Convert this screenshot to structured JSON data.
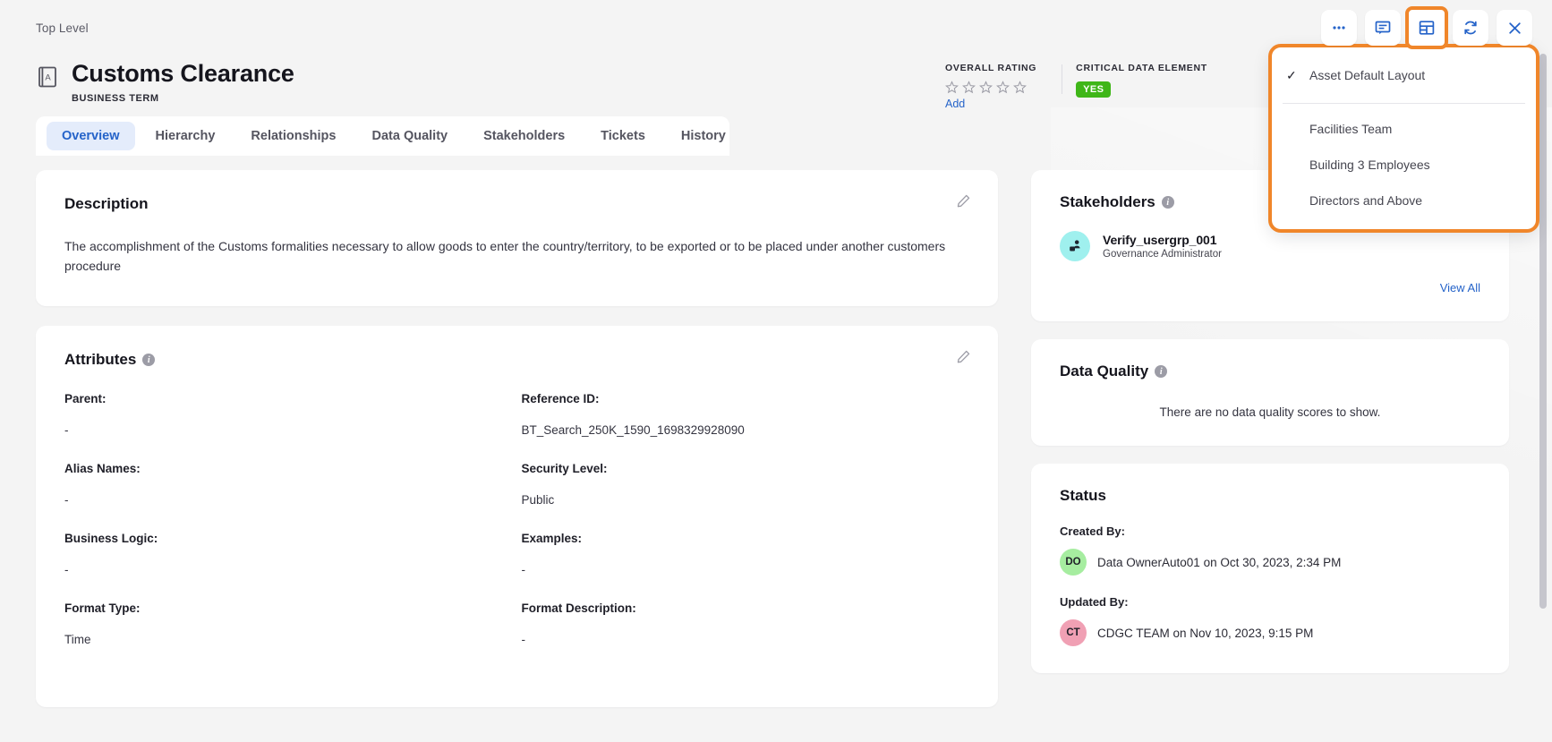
{
  "breadcrumb": "Top Level",
  "header": {
    "title": "Customs Clearance",
    "asset_type": "BUSINESS TERM",
    "asset_icon": "business-term-icon"
  },
  "toolbar": {
    "buttons": [
      {
        "name": "more-options-button",
        "icon": "ellipsis-icon",
        "label": ""
      },
      {
        "name": "comments-button",
        "icon": "comment-icon",
        "label": ""
      },
      {
        "name": "layout-button",
        "icon": "layout-grid-icon",
        "label": "",
        "focused": true
      },
      {
        "name": "refresh-button",
        "icon": "refresh-icon",
        "label": ""
      },
      {
        "name": "close-button",
        "icon": "close-icon",
        "label": ""
      }
    ]
  },
  "layout_menu": {
    "default_item": "Asset Default Layout",
    "default_checked": true,
    "check_glyph": "✓",
    "items": [
      "Facilities Team",
      "Building 3 Employees",
      "Directors and Above"
    ]
  },
  "meta": {
    "rating_label": "OVERALL RATING",
    "rating_value": 0,
    "rating_max": 5,
    "add_label": "Add",
    "cde_label": "CRITICAL DATA ELEMENT",
    "cde_value": "YES"
  },
  "tabs": [
    {
      "label": "Overview",
      "active": true
    },
    {
      "label": "Hierarchy",
      "active": false
    },
    {
      "label": "Relationships",
      "active": false
    },
    {
      "label": "Data Quality",
      "active": false
    },
    {
      "label": "Stakeholders",
      "active": false
    },
    {
      "label": "Tickets",
      "active": false
    },
    {
      "label": "History",
      "active": false
    }
  ],
  "description": {
    "title": "Description",
    "text": "The accomplishment of the Customs formalities necessary to allow goods to enter the country/territory, to be exported or to be placed under another customers procedure"
  },
  "attributes": {
    "title": "Attributes",
    "items": [
      {
        "key": "Parent:",
        "value": "-"
      },
      {
        "key": "Reference ID:",
        "value": "BT_Search_250K_1590_1698329928090"
      },
      {
        "key": "Alias Names:",
        "value": "-"
      },
      {
        "key": "Security Level:",
        "value": "Public"
      },
      {
        "key": "Business Logic:",
        "value": "-"
      },
      {
        "key": "Examples:",
        "value": "-"
      },
      {
        "key": "Format Type:",
        "value": "Time"
      },
      {
        "key": "Format Description:",
        "value": "-"
      }
    ]
  },
  "stakeholders": {
    "title": "Stakeholders",
    "person_name": "Verify_usergrp_001",
    "person_role": "Governance Administrator",
    "avatar_icon": "user-group-icon",
    "view_all": "View All"
  },
  "data_quality": {
    "title": "Data Quality",
    "empty_text": "There are no data quality scores to show."
  },
  "status": {
    "title": "Status",
    "created_label": "Created By:",
    "created_initials": "DO",
    "created_text": "Data OwnerAuto01 on Oct 30, 2023, 2:34 PM",
    "updated_label": "Updated By:",
    "updated_initials": "CT",
    "updated_text": "CDGC TEAM on Nov 10, 2023, 9:15 PM"
  },
  "colors": {
    "accent_blue": "#2563c9",
    "highlight_orange": "#f0862a",
    "badge_green": "#3fb618",
    "avatar_teal": "#9ff0ee",
    "avatar_green": "#a6eda0",
    "avatar_pink": "#f0a0b4"
  }
}
